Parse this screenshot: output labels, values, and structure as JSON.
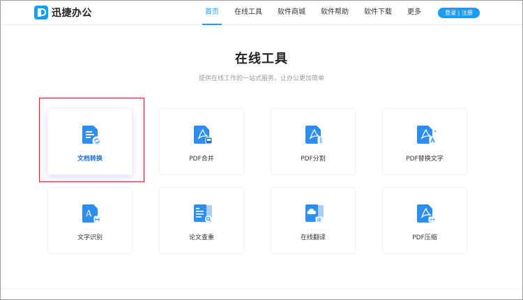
{
  "header": {
    "logo_text": "迅捷办公",
    "nav": [
      {
        "label": "首页",
        "active": true
      },
      {
        "label": "在线工具",
        "active": false
      },
      {
        "label": "软件商城",
        "active": false
      },
      {
        "label": "软件帮助",
        "active": false
      },
      {
        "label": "软件下载",
        "active": false
      },
      {
        "label": "更多",
        "active": false
      }
    ],
    "login_label": "登录 | 注册"
  },
  "main": {
    "title": "在线工具",
    "subtitle": "提供在线工作的一站式服务，让办公更加简单"
  },
  "tools": [
    {
      "label": "文档转换",
      "icon": "document-convert-icon",
      "highlighted": true
    },
    {
      "label": "PDF合并",
      "icon": "pdf-merge-icon",
      "highlighted": false
    },
    {
      "label": "PDF分割",
      "icon": "pdf-split-icon",
      "highlighted": false
    },
    {
      "label": "PDF替换文字",
      "icon": "pdf-replace-text-icon",
      "highlighted": false
    },
    {
      "label": "文字识别",
      "icon": "text-recognition-icon",
      "highlighted": false
    },
    {
      "label": "论文查重",
      "icon": "paper-check-icon",
      "highlighted": false
    },
    {
      "label": "在线翻译",
      "icon": "online-translate-icon",
      "highlighted": false
    },
    {
      "label": "PDF压缩",
      "icon": "pdf-compress-icon",
      "highlighted": false
    }
  ],
  "colors": {
    "accent": "#1a9cf0",
    "icon_blue": "#2b8ef0",
    "highlight_border": "#e02020"
  }
}
